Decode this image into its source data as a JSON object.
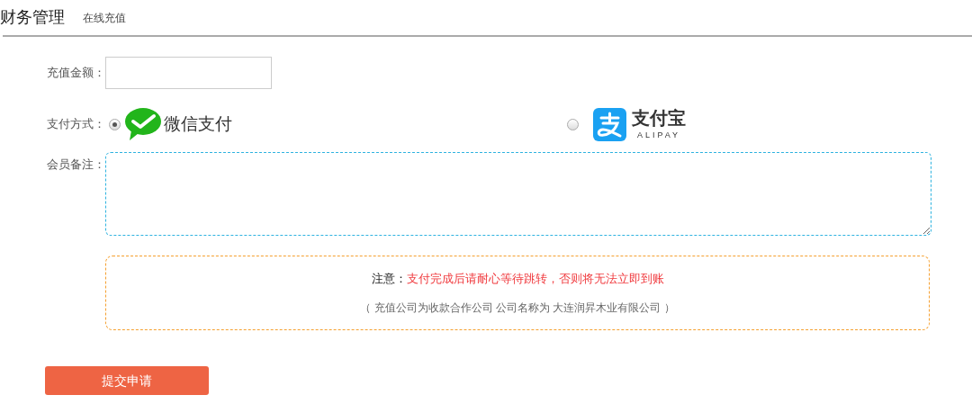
{
  "header": {
    "title": "财务管理",
    "subtitle": "在线充值"
  },
  "amount": {
    "label": "充值金额："
  },
  "payment": {
    "label": "支付方式：",
    "options": [
      {
        "kind": "wechat",
        "selected": true,
        "name": "微信支付"
      },
      {
        "kind": "alipay",
        "selected": false,
        "name": "支付宝",
        "sub": "ALIPAY"
      }
    ]
  },
  "remark": {
    "label": "会员备注："
  },
  "notice": {
    "label": "注意：",
    "message": "支付完成后请耐心等待跳转，否则将无法立即到账",
    "detail": "（ 充值公司为收款合作公司 公司名称为 大连润昇木业有限公司 ）"
  },
  "submit": {
    "label": "提交申请"
  }
}
